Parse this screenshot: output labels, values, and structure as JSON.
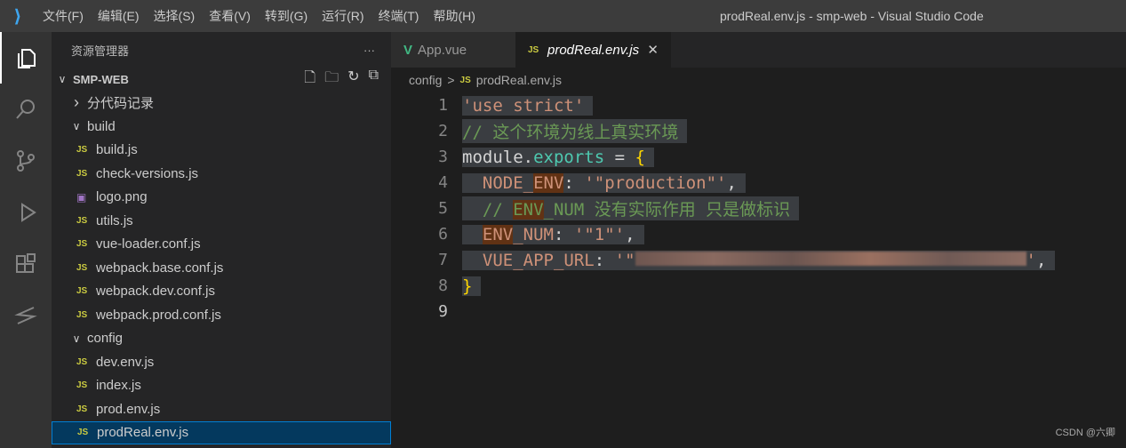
{
  "titlebar": {
    "menus": [
      "文件(F)",
      "编辑(E)",
      "选择(S)",
      "查看(V)",
      "转到(G)",
      "运行(R)",
      "终端(T)",
      "帮助(H)"
    ],
    "title": "prodReal.env.js - smp-web - Visual Studio Code"
  },
  "sidebar": {
    "title": "资源管理器",
    "more": "···",
    "root": "SMP-WEB",
    "items": [
      {
        "label": "分代码记录",
        "type": "folder",
        "open": false,
        "depth": 1
      },
      {
        "label": "build",
        "type": "folder",
        "open": true,
        "depth": 1
      },
      {
        "label": "build.js",
        "type": "js",
        "depth": 2
      },
      {
        "label": "check-versions.js",
        "type": "js",
        "depth": 2
      },
      {
        "label": "logo.png",
        "type": "png",
        "depth": 2
      },
      {
        "label": "utils.js",
        "type": "js",
        "depth": 2
      },
      {
        "label": "vue-loader.conf.js",
        "type": "js",
        "depth": 2
      },
      {
        "label": "webpack.base.conf.js",
        "type": "js",
        "depth": 2
      },
      {
        "label": "webpack.dev.conf.js",
        "type": "js",
        "depth": 2
      },
      {
        "label": "webpack.prod.conf.js",
        "type": "js",
        "depth": 2
      },
      {
        "label": "config",
        "type": "folder",
        "open": true,
        "depth": 1
      },
      {
        "label": "dev.env.js",
        "type": "js",
        "depth": 2
      },
      {
        "label": "index.js",
        "type": "js",
        "depth": 2
      },
      {
        "label": "prod.env.js",
        "type": "js",
        "depth": 2
      },
      {
        "label": "prodReal.env.js",
        "type": "js",
        "depth": 2,
        "selected": true
      }
    ]
  },
  "tabs": [
    {
      "label": "App.vue",
      "icon": "V"
    },
    {
      "label": "prodReal.env.js",
      "icon": "JS",
      "close": "✕"
    }
  ],
  "breadcrumb": {
    "folder": "config",
    "sep": ">",
    "icon": "JS",
    "file": "prodReal.env.js"
  },
  "code": [
    [
      [
        "str",
        "'use strict'"
      ]
    ],
    [
      [
        "cmt",
        "// 这个环境为线上真实环境"
      ]
    ],
    [
      [
        "plain",
        "module."
      ],
      [
        "prop",
        "exports"
      ],
      [
        "plain",
        " = "
      ],
      [
        "brace",
        "{"
      ]
    ],
    [
      [
        "plain",
        "  "
      ],
      [
        "key",
        "NODE_"
      ],
      [
        "key hl",
        "ENV"
      ],
      [
        "plain",
        ": "
      ],
      [
        "str",
        "'\"production\"'"
      ],
      [
        "plain",
        ","
      ]
    ],
    [
      [
        "plain",
        "  "
      ],
      [
        "cmt",
        "// "
      ],
      [
        "cmt hl",
        "ENV"
      ],
      [
        "cmt",
        "_NUM 没有实际作用 只是做标识"
      ]
    ],
    [
      [
        "plain",
        "  "
      ],
      [
        "key hl",
        "ENV"
      ],
      [
        "key",
        "_NUM"
      ],
      [
        "plain",
        ": "
      ],
      [
        "str",
        "'\"1\"'"
      ],
      [
        "plain",
        ","
      ]
    ],
    [
      [
        "plain",
        "  "
      ],
      [
        "key",
        "VUE_APP_URL"
      ],
      [
        "plain",
        ": "
      ],
      [
        "str",
        "'\""
      ],
      [
        "blur",
        ""
      ],
      [
        "str",
        "'"
      ],
      [
        "plain",
        ","
      ]
    ],
    [
      [
        "brace",
        "}"
      ]
    ],
    []
  ],
  "watermark": "CSDN @六卿"
}
